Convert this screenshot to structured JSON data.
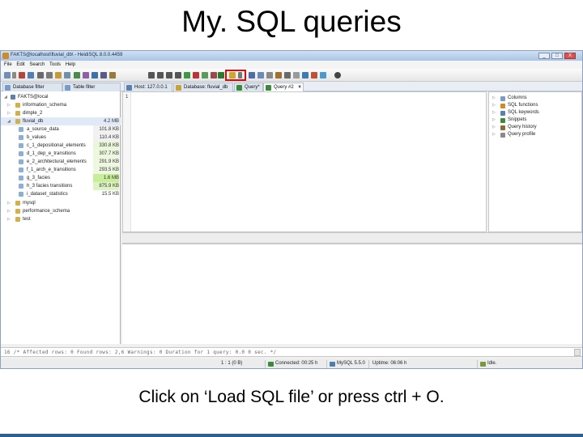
{
  "slide": {
    "title": "My. SQL queries",
    "caption": "Click on ‘Load SQL file’ or press ctrl + O."
  },
  "window": {
    "title": "FAKTS@localhost\\fluvial_db\\ - HeidiSQL 8.0.0.4459",
    "minimize_label": "_",
    "maximize_label": "□",
    "close_label": "X"
  },
  "menu": [
    "File",
    "Edit",
    "Search",
    "Tools",
    "Help"
  ],
  "tabs": [
    {
      "label": "Database filter",
      "icon": "funnel-icon"
    },
    {
      "label": "Table filter",
      "icon": "table-icon"
    },
    {
      "label": "Host: 127.0.0.1",
      "icon": "host-icon"
    },
    {
      "label": "Database: fluvial_db",
      "icon": "database-icon"
    },
    {
      "label": "Query*",
      "icon": "query-icon"
    },
    {
      "label": "Query #2",
      "icon": "query-icon",
      "active": true
    },
    {
      "close": "×"
    }
  ],
  "tree": {
    "root": "FAKTS@local",
    "databases": [
      {
        "label": "information_schema",
        "expander": "▷"
      },
      {
        "label": "dimple_2",
        "expander": "▷"
      },
      {
        "label": "fluvial_db",
        "size": "4.2 MB",
        "expander": "◢",
        "expanded": true
      }
    ],
    "tables": [
      {
        "label": "a_source_data",
        "size": "101.8 KB"
      },
      {
        "label": "b_values",
        "size": "110.4 KB"
      },
      {
        "label": "c_1_depositional_elements",
        "size": "330.8 KB"
      },
      {
        "label": "d_1_dep_e_transitions",
        "size": "307.7 KB"
      },
      {
        "label": "e_2_architectural_elements",
        "size": "291.9 KB"
      },
      {
        "label": "f_1_arch_e_transitions",
        "size": "293.5 KB"
      },
      {
        "label": "g_3_facies",
        "size": "1.6 MB"
      },
      {
        "label": "h_3 facies transitions",
        "size": "875.9 KB"
      },
      {
        "label": "i_dataset_statistics",
        "size": "15.5 KB"
      }
    ],
    "after": [
      {
        "label": "mysql",
        "expander": "▷"
      },
      {
        "label": "performance_schema",
        "expander": "▷"
      },
      {
        "label": "test",
        "expander": "▷"
      }
    ]
  },
  "editor": {
    "line_number": "1"
  },
  "helpers": [
    {
      "label": "Columns",
      "icon": "columns-icon"
    },
    {
      "label": "SQL functions",
      "icon": "functions-icon"
    },
    {
      "label": "SQL keywords",
      "icon": "keywords-icon"
    },
    {
      "label": "Snippets",
      "icon": "snippets-icon"
    },
    {
      "label": "Query history",
      "icon": "history-icon"
    },
    {
      "label": "Query profile",
      "icon": "profile-icon"
    }
  ],
  "log": "16 /* Affected rows: 0  Found rows: 2,6  Warnings: 0  Duration for 1 query: 0.0 0 sec. */",
  "status": {
    "position": "1 : 1 (0 B)",
    "connected": "Connected: 00:25 h",
    "server": "MySQL 5.5.0",
    "uptime": "Uptime: 06:06 h",
    "state": "Idle."
  },
  "colors": {
    "highlight_box": "#d01010",
    "bottom_bar": "#2f5f8f",
    "table_size_bar": "#c8ee9a"
  }
}
